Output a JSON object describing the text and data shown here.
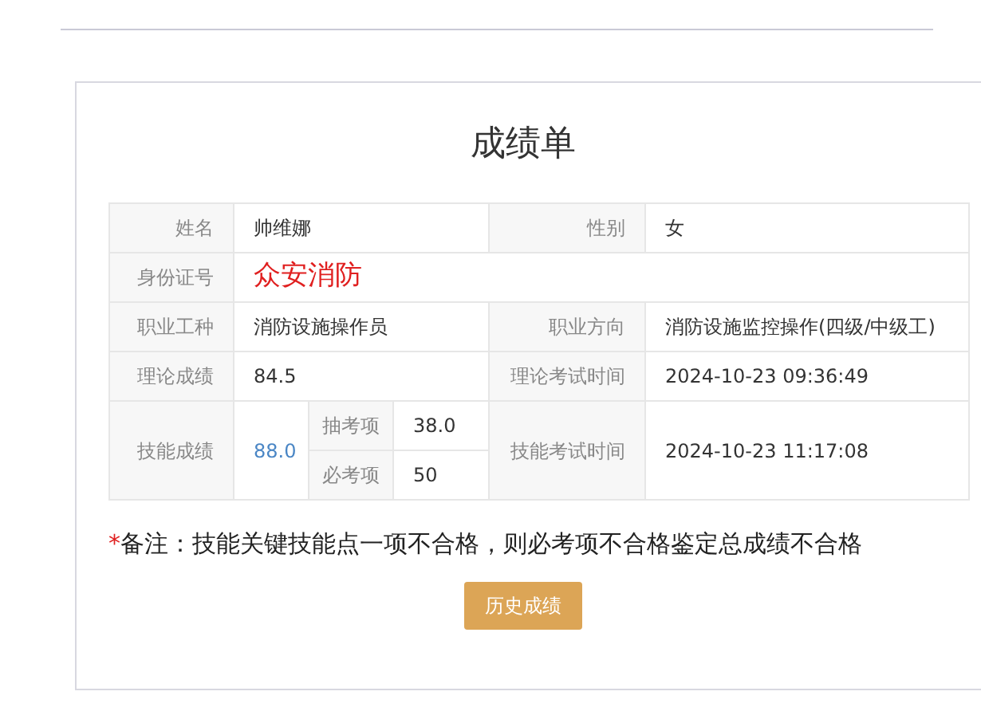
{
  "title": "成绩单",
  "rows": [
    {
      "kind": "pair",
      "label": "姓名",
      "value": "帅维娜",
      "label_2": "性别",
      "value_2": "女"
    },
    {
      "kind": "single",
      "label": "身份证号",
      "value": "众安消防"
    },
    {
      "kind": "pair",
      "label": "职业工种",
      "value": "消防设施操作员",
      "label_2": "职业方向",
      "value_2": "消防设施监控操作(四级/中级工)"
    },
    {
      "kind": "pair",
      "label": "理论成绩",
      "value": "84.5",
      "label_2": "理论考试时间",
      "value_2": "2024-10-23 09:36:49"
    },
    {
      "kind": "skill",
      "label": "技能成绩",
      "value": "88.0",
      "sub": [
        {
          "label": "抽考项",
          "value": "38.0"
        },
        {
          "label": "必考项",
          "value": "50"
        }
      ],
      "label_2": "技能考试时间",
      "value_2": "2024-10-23 11:17:08"
    }
  ],
  "note": {
    "mark": "*",
    "text": "备注：技能关键技能点一项不合格，则必考项不合格鉴定总成绩不合格"
  },
  "button": "历史成绩"
}
